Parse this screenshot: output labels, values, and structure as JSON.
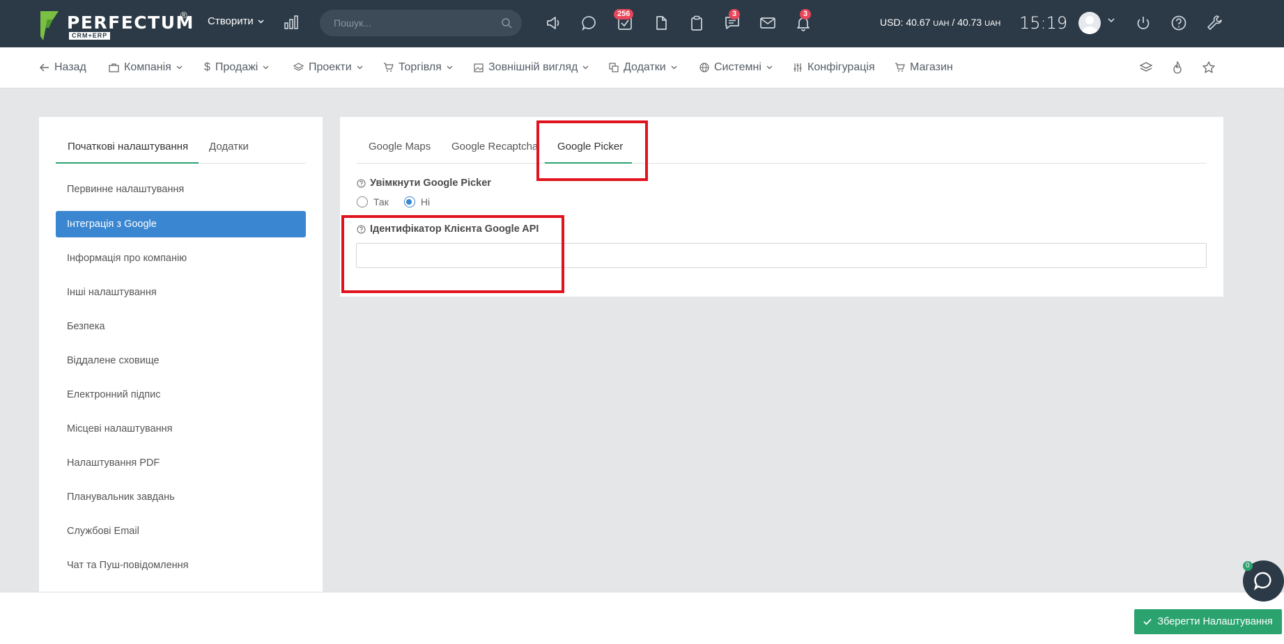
{
  "header": {
    "logo_text": "PERFECTUM",
    "logo_reg": "®",
    "logo_sub": "CRM+ERP",
    "create_label": "Створити",
    "search_placeholder": "Пошук...",
    "badges": {
      "tasks": "256",
      "chat": "3",
      "notifications": "3"
    },
    "currency": "USD: 40.67",
    "currency_unit1": "UAH",
    "currency_sep": " / 40.73 ",
    "currency_unit2": "UAH",
    "time": "15:19"
  },
  "nav": {
    "back": "Назад",
    "items": [
      "Компанія",
      "Продажі",
      "Проекти",
      "Торгівля",
      "Зовнішній вигляд",
      "Додатки",
      "Системні",
      "Конфігурація",
      "Магазин"
    ]
  },
  "left_panel": {
    "tabs": [
      "Початкові налаштування",
      "Додатки"
    ],
    "items": [
      "Первинне налаштування",
      "Інтеграція з Google",
      "Інформація про компанію",
      "Інші налаштування",
      "Безпека",
      "Віддалене сховище",
      "Електронний підпис",
      "Місцеві налаштування",
      "Налаштування PDF",
      "Планувальник завдань",
      "Службові Email",
      "Чат та Пуш-повідомлення"
    ]
  },
  "right_panel": {
    "tabs": [
      "Google Maps",
      "Google Recaptcha",
      "Google Picker"
    ],
    "enable_label": "Увімкнути Google Picker",
    "radio_yes": "Так",
    "radio_no": "Ні",
    "client_id_label": "Ідентифікатор Клієнта Google API",
    "client_id_value": ""
  },
  "footer": {
    "save_label": "Зберегти Налаштування"
  },
  "chat_widget": {
    "count": "0"
  },
  "colors": {
    "topbar": "#2c3a47",
    "accent_green": "#2aa36f",
    "active_blue": "#3a86d0",
    "highlight_red": "#e0141e"
  }
}
